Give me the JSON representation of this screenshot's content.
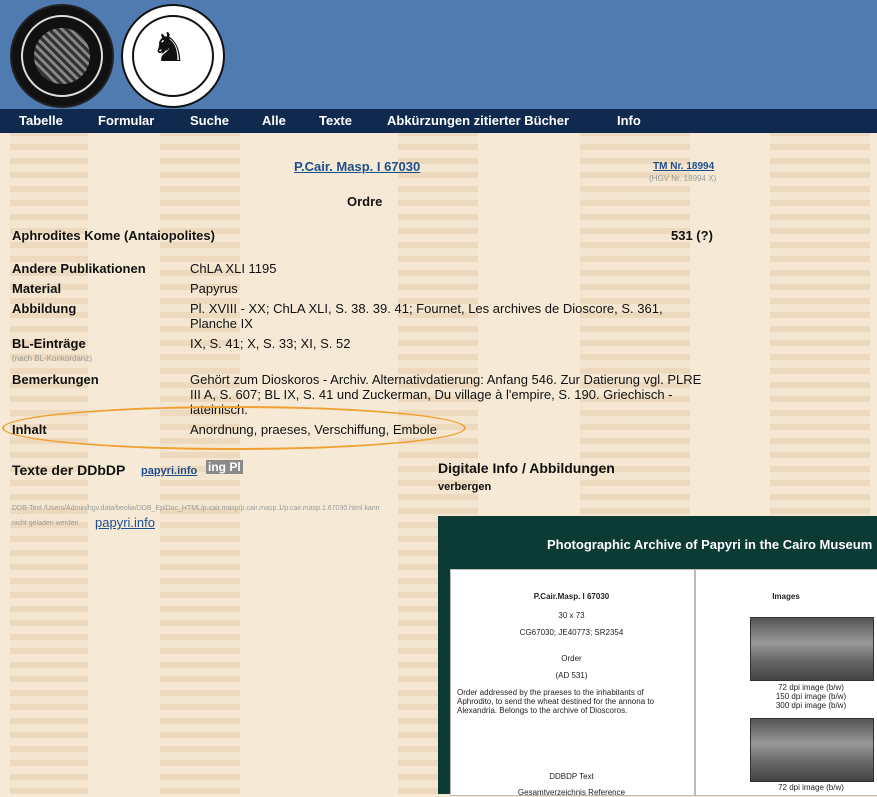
{
  "header": {
    "seal1_icon": "university-seal",
    "seal2_icon": "lion-seal"
  },
  "nav": {
    "items": [
      "Tabelle",
      "Formular",
      "Suche",
      "Alle",
      "Texte",
      "Abkürzungen zitierter Bücher",
      "Info"
    ]
  },
  "doc": {
    "title": "P.Cair. Masp. I 67030",
    "tm_link": "TM Nr. 18994",
    "hgv_note": "(HGV Nr. 18994 X)",
    "subtitle": "Ordre",
    "place": "Aphrodites Kome (Antaiopolites)",
    "date": "531 (?)",
    "fields": [
      {
        "label": "Andere Publikationen",
        "value": "ChLA XLI 1195"
      },
      {
        "label": "Material",
        "value": "Papyrus"
      },
      {
        "label": "Abbildung",
        "value": "Pl. XVIII - XX; ChLA XLI, S. 38. 39. 41; Fournet, Les archives de Dioscore, S. 361, Planche IX"
      },
      {
        "label": "BL-Einträge",
        "value": "IX, S. 41; X, S. 33; XI, S. 52"
      },
      {
        "label": "Bemerkungen",
        "value": "Gehört zum Dioskoros - Archiv. Alternativdatierung: Anfang 546. Zur Datierung vgl. PLRE III A, S. 607; BL IX, S. 41 und Zuckerman, Du village à l'empire, S. 190. Griechisch - lateinisch."
      },
      {
        "label": "Inhalt",
        "value": "Anordnung, praeses, Verschiffung, Embole"
      }
    ],
    "bl_note": "(nach BL-Konkordanz)"
  },
  "ddbdp": {
    "heading": "Texte der DDbDP",
    "link": "papyri.info",
    "badge": "ing Pl",
    "path": "DDB-Text /Users/Admin/hgv.data/beolia/DDB_EpiDoc_HTML/p.cair.masp/p.cair.masp.1/p.cair.masp.1.67030.html kann",
    "not_loaded": "nicht geladen werden",
    "link2": "papyri.info"
  },
  "digital": {
    "heading": "Digitale Info / Abbildungen",
    "hide": "verbergen"
  },
  "panel": {
    "title": "Photographic Archive of Papyri in the Cairo Museum",
    "item_title": "P.Cair.Masp. I 67030",
    "dims": "30 x 73",
    "ids": "CG67030; JE40773; SR2354",
    "type": "Order",
    "date": "(AD 531)",
    "desc": [
      "Order addressed by the praeses to the inhabitants of",
      "Aphrodito, to send the wheat destined for the annona to",
      "Alexandria. Belongs to the archive of Dioscoros."
    ],
    "ddbdp": "DDBDP Text",
    "gesamt": "Gesamtverzeichnis Reference",
    "images_heading": "Images",
    "img_links": [
      "72 dpi image (b/w)",
      "150 dpi image (b/w)",
      "300 dpi image (b/w)"
    ],
    "img_links2": [
      "72 dpi image (b/w)"
    ]
  }
}
